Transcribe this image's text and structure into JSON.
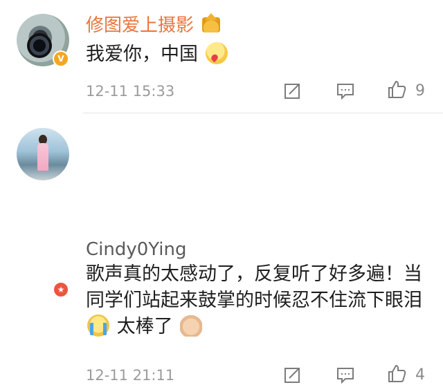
{
  "comments": [
    {
      "username": "修图爱上摄影",
      "text_parts": [
        "我爱你，中国"
      ],
      "time": "12-11 15:33",
      "like_count": "9",
      "icons": [
        "camera-avatar",
        "vip-crown-icon",
        "kiss-emoji",
        "share-icon",
        "reply-icon",
        "like-icon"
      ]
    },
    {
      "username": "Cindy0Ying",
      "text_parts": [
        "歌声真的太感动了，反复听了好多遍！当同学们站起来鼓掌的时候忍不住流下眼泪",
        "太棒了"
      ],
      "time": "12-11 21:11",
      "like_count": "4",
      "icons": [
        "girl-avatar",
        "crying-emoji",
        "clapping-emoji",
        "share-icon",
        "reply-icon",
        "like-icon"
      ]
    }
  ],
  "colors": {
    "vip_username": "#e8743a",
    "username": "#5a5a5a",
    "meta_text": "#9b9b9b",
    "divider": "#e3e3e3"
  }
}
